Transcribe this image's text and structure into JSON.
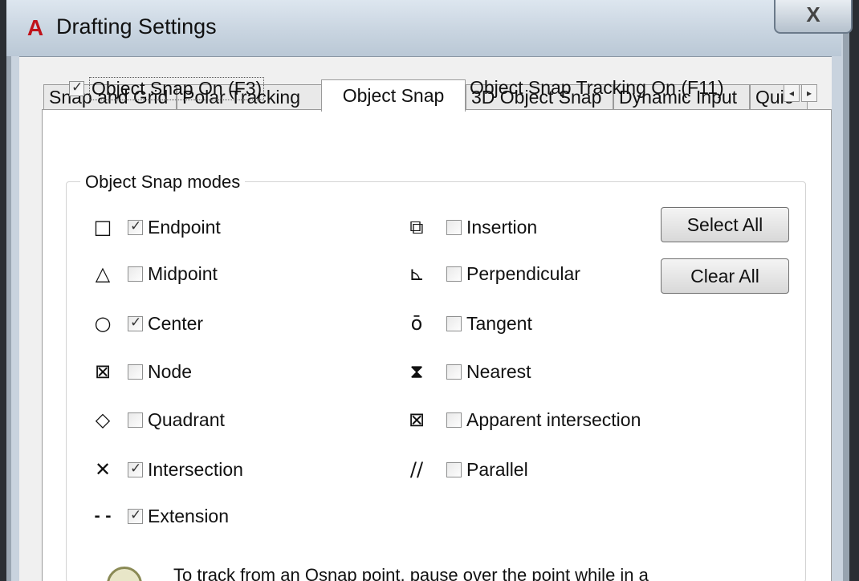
{
  "window": {
    "title": "Drafting Settings",
    "app_icon": "A",
    "close_glyph": "X"
  },
  "tabs": [
    {
      "label": "Snap and Grid",
      "active": false
    },
    {
      "label": "Polar Tracking",
      "active": false
    },
    {
      "label": "Object Snap",
      "active": true
    },
    {
      "label": "3D Object Snap",
      "active": false
    },
    {
      "label": "Dynamic Input",
      "active": false
    },
    {
      "label": "Quic",
      "active": false
    }
  ],
  "tab_scroll": {
    "left": "◂",
    "right": "▸"
  },
  "options": {
    "object_snap_on": {
      "label": "Object Snap On (F3)",
      "checked": true
    },
    "object_snap_tracking_on": {
      "label": "Object Snap Tracking On (F11)",
      "checked": true
    }
  },
  "modes_group": {
    "title": "Object Snap modes",
    "left": [
      {
        "label": "Endpoint",
        "symbol": "□",
        "checked": true
      },
      {
        "label": "Midpoint",
        "symbol": "△",
        "checked": false
      },
      {
        "label": "Center",
        "symbol": "○",
        "checked": true
      },
      {
        "label": "Node",
        "symbol": "⊠",
        "checked": false
      },
      {
        "label": "Quadrant",
        "symbol": "◇",
        "checked": false
      },
      {
        "label": "Intersection",
        "symbol": "✕",
        "checked": true
      },
      {
        "label": "Extension",
        "symbol": "- -",
        "checked": true
      }
    ],
    "right": [
      {
        "label": "Insertion",
        "symbol": "⧉",
        "checked": false
      },
      {
        "label": "Perpendicular",
        "symbol": "⊾",
        "checked": false
      },
      {
        "label": "Tangent",
        "symbol": "ō",
        "checked": false
      },
      {
        "label": "Nearest",
        "symbol": "⧗",
        "checked": false
      },
      {
        "label": "Apparent intersection",
        "symbol": "⊠",
        "checked": false
      },
      {
        "label": "Parallel",
        "symbol": "∕∕",
        "checked": false
      }
    ],
    "buttons": {
      "select_all": "Select All",
      "clear_all": "Clear All"
    }
  },
  "hint": {
    "text": "To track from an Osnap point, pause over the point while in a"
  }
}
